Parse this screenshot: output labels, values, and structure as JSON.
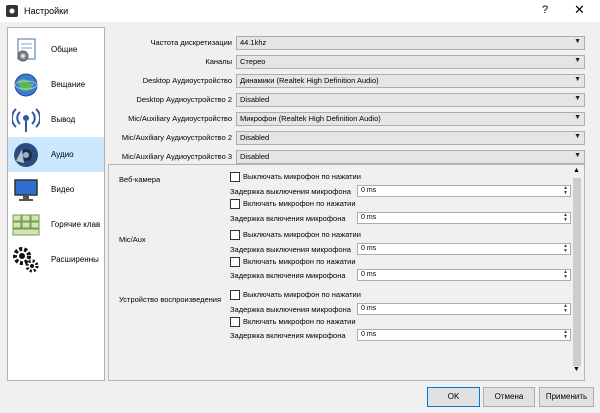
{
  "window": {
    "title": "Настройки",
    "help_glyph": "?",
    "close_glyph": "✕"
  },
  "sidebar": {
    "items": [
      {
        "label": "Общие",
        "icon": "gear-document-icon"
      },
      {
        "label": "Вещание",
        "icon": "globe-icon"
      },
      {
        "label": "Вывод",
        "icon": "broadcast-icon"
      },
      {
        "label": "Аудио",
        "icon": "speaker-icon",
        "active": true
      },
      {
        "label": "Видео",
        "icon": "monitor-icon"
      },
      {
        "label": "Горячие клав",
        "icon": "keyboard-icon"
      },
      {
        "label": "Расширенны",
        "icon": "gears-icon"
      }
    ]
  },
  "audio": {
    "fields": [
      {
        "label": "Частота дискретизации",
        "value": "44.1khz"
      },
      {
        "label": "Каналы",
        "value": "Стерео"
      },
      {
        "label": "Desktop Аудиоустройство",
        "value": "Динамики (Realtek High Definition Audio)"
      },
      {
        "label": "Desktop Аудиоустройство 2",
        "value": "Disabled"
      },
      {
        "label": "Mic/Auxiliary Аудиоустройство",
        "value": "Микрофон (Realtek High Definition Audio)"
      },
      {
        "label": "Mic/Auxiliary Аудиоустройство 2",
        "value": "Disabled"
      },
      {
        "label": "Mic/Auxiliary Аудиоустройство 3",
        "value": "Disabled"
      }
    ]
  },
  "hotkeys": {
    "devices": [
      {
        "name": "Веб-камера",
        "mute_label": "Выключать микрофон по нажатии",
        "mute_delay_label": "Задержка выключения микрофона",
        "mute_delay": "0 ms",
        "ptt_label": "Включать микрофон по нажатии",
        "ptt_delay_label": "Задержка включения микрофона",
        "ptt_delay": "0 ms"
      },
      {
        "name": "Mic/Aux",
        "mute_label": "Выключать микрофон по нажатии",
        "mute_delay_label": "Задержка выключения микрофона",
        "mute_delay": "0 ms",
        "ptt_label": "Включать микрофон по нажатии",
        "ptt_delay_label": "Задержка включения микрофона",
        "ptt_delay": "0 ms"
      },
      {
        "name": "Устройство воспроизведения",
        "mute_label": "Выключать микрофон по нажатии",
        "mute_delay_label": "Задержка выключения микрофона",
        "mute_delay": "0 ms",
        "ptt_label": "Включать микрофон по нажатии",
        "ptt_delay_label": "Задержка включения микрофона",
        "ptt_delay": "0 ms"
      }
    ]
  },
  "buttons": {
    "ok": "OK",
    "cancel": "Отмена",
    "apply": "Применить"
  },
  "colors": {
    "selection": "#cce8ff",
    "accent": "#0078d7"
  }
}
